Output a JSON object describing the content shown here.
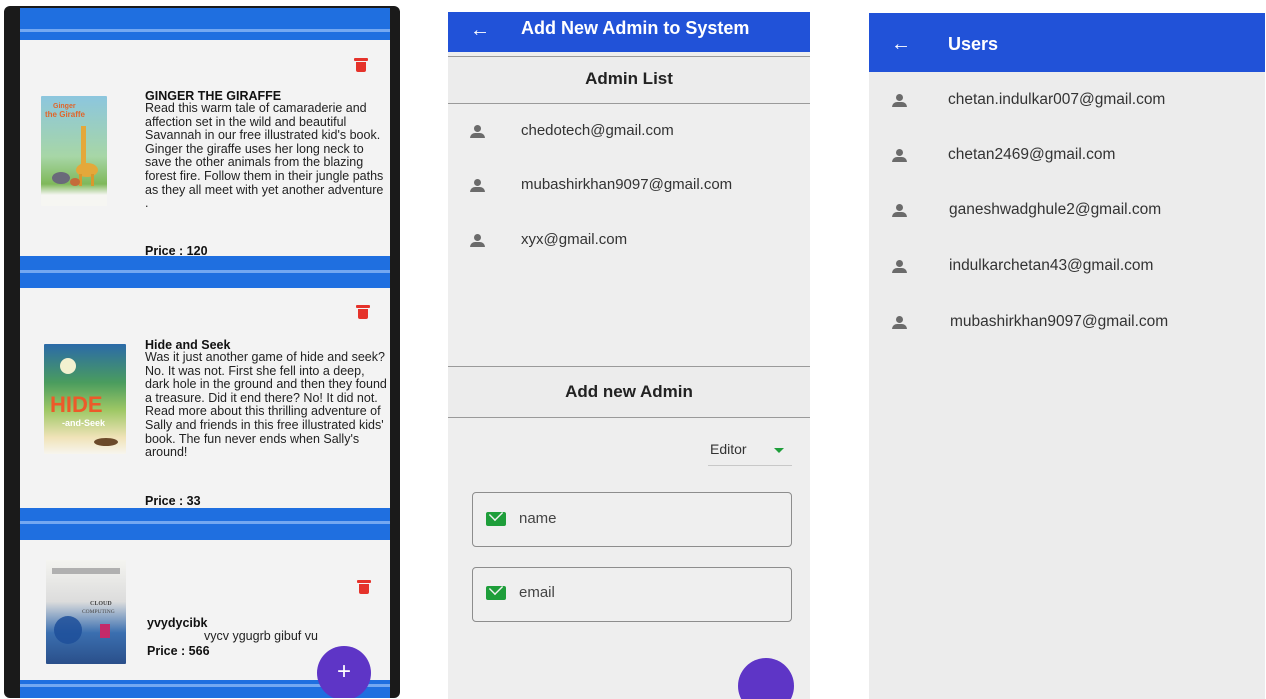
{
  "books_screen": {
    "delete_icon": "trash-icon",
    "add_icon": "plus-icon",
    "add_label": "+",
    "books": [
      {
        "title": "GINGER THE GIRAFFE",
        "description": "Read this warm tale of camaraderie and affection set in the wild and beautiful Savannah in our free illustrated kid's book. Ginger the giraffe uses her long neck to save the other animals from the blazing forest fire. Follow them in their jungle paths as they all meet with yet another adventure .",
        "price": "Price : 120"
      },
      {
        "title": "Hide and Seek",
        "description": "Was it just another game of hide and seek? No. It was not. First she fell into a deep, dark hole in the ground and then they found a treasure. Did it end there? No! It did not. Read more about this thrilling adventure of Sally and friends in this free illustrated kids' book. The fun never ends when Sally's around!",
        "price": "Price : 33"
      },
      {
        "title": "yvydycibk",
        "description": "vycv ygugrb gibuf vu",
        "price": "Price : 566"
      }
    ]
  },
  "admin_screen": {
    "title": "Add New Admin to System",
    "back_icon": "arrow-left-icon",
    "admin_list_header": "Admin List",
    "admins": [
      "chedotech@gmail.com",
      "mubashirkhan9097@gmail.com",
      "xyx@gmail.com"
    ],
    "add_admin_header": "Add new Admin",
    "role_selected": "Editor",
    "name_placeholder": "name",
    "email_placeholder": "email",
    "colors": {
      "appbar": "#2152d8",
      "mail_icon": "#1e9e3a",
      "fab": "#5e35c6"
    }
  },
  "users_screen": {
    "title": "Users",
    "back_icon": "arrow-left-icon",
    "users": [
      "chetan.indulkar007@gmail.com",
      "chetan2469@gmail.com",
      "ganeshwadghule2@gmail.com",
      "indulkarchetan43@gmail.com",
      "mubashirkhan9097@gmail.com"
    ]
  }
}
